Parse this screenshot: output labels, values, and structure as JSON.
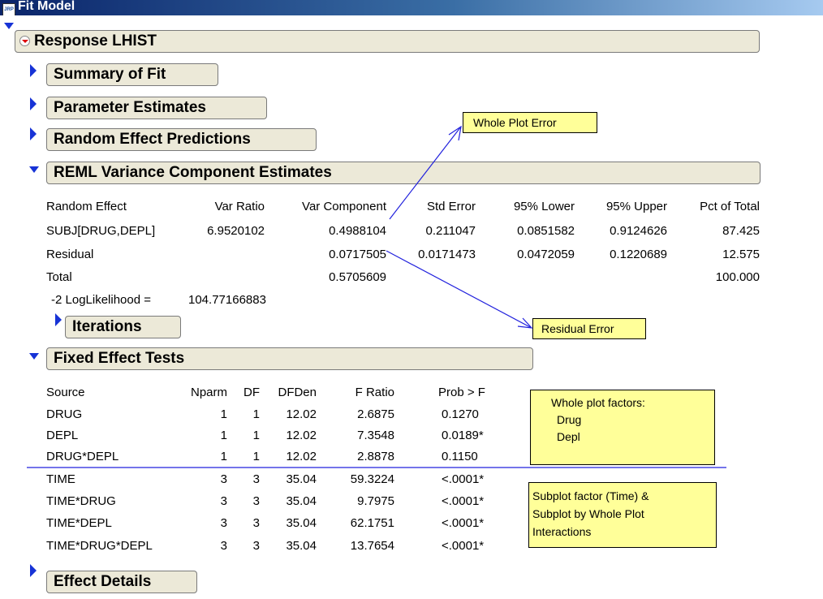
{
  "window": {
    "title": "Fit Model",
    "icon": "JRP"
  },
  "outline": {
    "response": "Response LHIST",
    "summary_of_fit": "Summary of Fit",
    "parameter_estimates": "Parameter Estimates",
    "random_effect_predictions": "Random Effect Predictions",
    "reml": "REML Variance Component Estimates",
    "iterations": "Iterations",
    "fixed_effect_tests": "Fixed Effect Tests",
    "effect_details": "Effect Details"
  },
  "reml_table": {
    "headers": [
      "Random Effect",
      "Var Ratio",
      "Var Component",
      "Std Error",
      "95% Lower",
      "95% Upper",
      "Pct of Total"
    ],
    "rows": [
      [
        "SUBJ[DRUG,DEPL]",
        "6.9520102",
        "0.4988104",
        "0.211047",
        "0.0851582",
        "0.9124626",
        "87.425"
      ],
      [
        "Residual",
        "",
        "0.0717505",
        "0.0171473",
        "0.0472059",
        "0.1220689",
        "12.575"
      ],
      [
        "Total",
        "",
        "0.5705609",
        "",
        "",
        "",
        "100.000"
      ]
    ],
    "loglik_label": "-2 LogLikelihood =",
    "loglik_value": "104.77166883"
  },
  "fixed_table": {
    "headers": [
      "Source",
      "Nparm",
      "DF",
      "DFDen",
      "F Ratio",
      "Prob > F"
    ],
    "rows": [
      [
        "DRUG",
        "1",
        "1",
        "12.02",
        "2.6875",
        "0.1270"
      ],
      [
        "DEPL",
        "1",
        "1",
        "12.02",
        "7.3548",
        "0.0189*"
      ],
      [
        "DRUG*DEPL",
        "1",
        "1",
        "12.02",
        "2.8878",
        "0.1150"
      ],
      [
        "TIME",
        "3",
        "3",
        "35.04",
        "59.3224",
        "<.0001*"
      ],
      [
        "TIME*DRUG",
        "3",
        "3",
        "35.04",
        "9.7975",
        "<.0001*"
      ],
      [
        "TIME*DEPL",
        "3",
        "3",
        "35.04",
        "62.1751",
        "<.0001*"
      ],
      [
        "TIME*DRUG*DEPL",
        "3",
        "3",
        "35.04",
        "13.7654",
        "<.0001*"
      ]
    ]
  },
  "annotations": {
    "whole_plot_error": "Whole Plot Error",
    "residual_error": "Residual Error",
    "whole_plot_factors": {
      "title": "Whole plot factors:",
      "items": [
        "Drug",
        "Depl"
      ]
    },
    "subplot": [
      "Subplot factor (Time) &",
      "Subplot by Whole Plot",
      "Interactions"
    ]
  },
  "colors": {
    "disclosure": "#1733d6",
    "note_bg": "#FFFF99",
    "annotation_line": "#2222dd"
  }
}
